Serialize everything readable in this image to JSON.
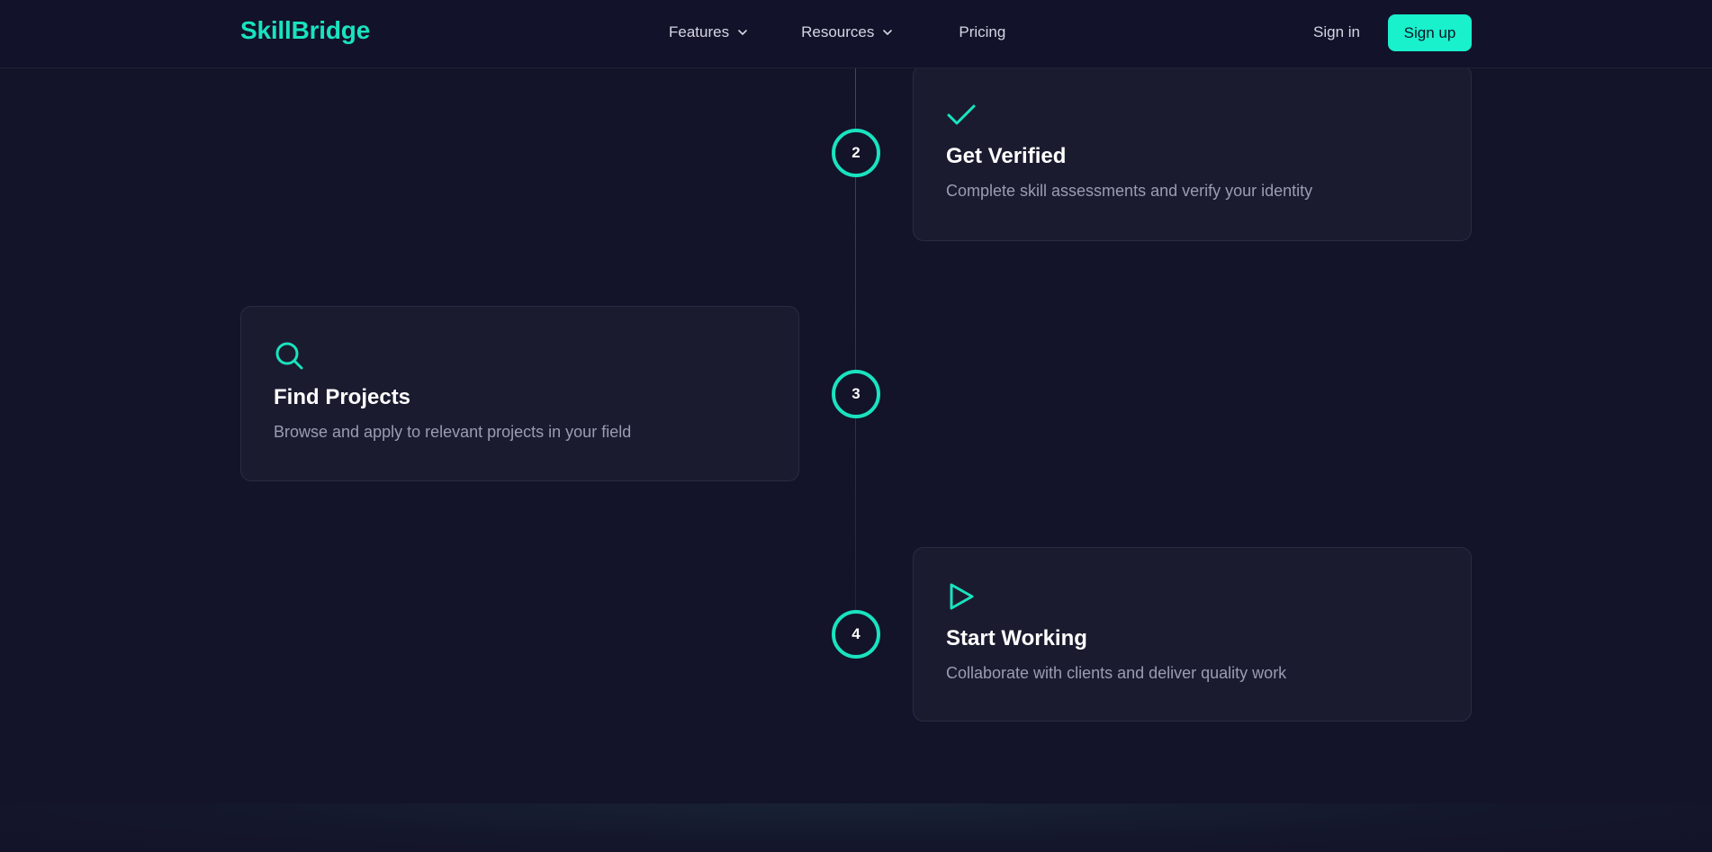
{
  "header": {
    "logo": "SkillBridge",
    "nav": [
      {
        "label": "Features",
        "has_dropdown": true
      },
      {
        "label": "Resources",
        "has_dropdown": true
      },
      {
        "label": "Pricing",
        "has_dropdown": false
      }
    ],
    "sign_in": "Sign in",
    "sign_up": "Sign up"
  },
  "steps": [
    {
      "number": "2",
      "icon": "check-icon",
      "title": "Get Verified",
      "description": "Complete skill assessments and verify your identity"
    },
    {
      "number": "3",
      "icon": "search-icon",
      "title": "Find Projects",
      "description": "Browse and apply to relevant projects in your field"
    },
    {
      "number": "4",
      "icon": "play-icon",
      "title": "Start Working",
      "description": "Collaborate with clients and deliver quality work"
    }
  ],
  "colors": {
    "accent": "#19e3bf",
    "button": "#19f0cc",
    "background": "#13132a",
    "card": "#1b1b30"
  }
}
